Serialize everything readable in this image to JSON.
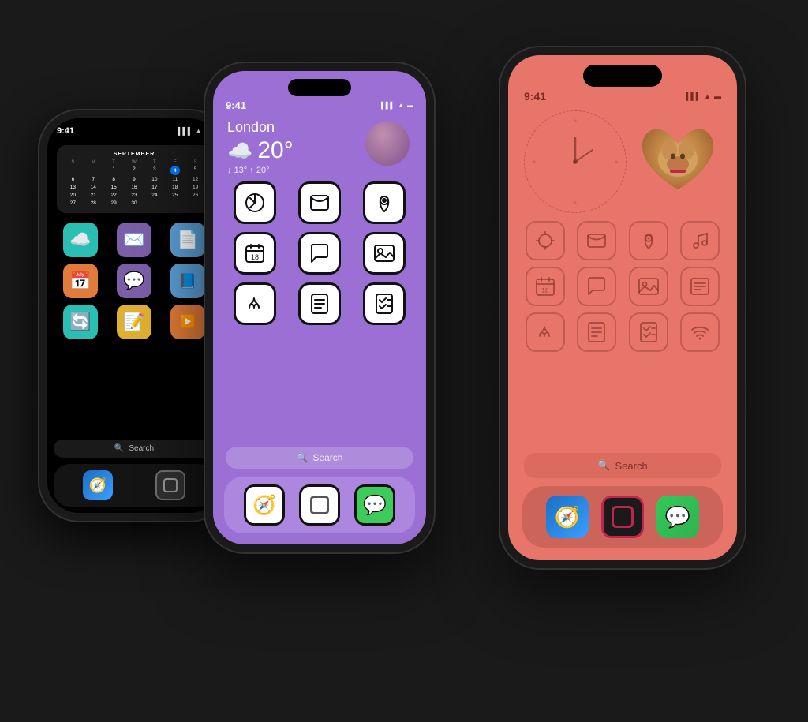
{
  "phones": {
    "left": {
      "time": "9:41",
      "background": "#000000",
      "calendar": {
        "month": "SEPTEMBER",
        "headers": [
          "S",
          "M",
          "T",
          "W",
          "T",
          "F",
          "S"
        ],
        "days": [
          "",
          "",
          "1",
          "2",
          "3",
          "4",
          "5",
          "6",
          "7",
          "8",
          "9",
          "10",
          "11",
          "12",
          "13",
          "14",
          "15",
          "16",
          "17",
          "18",
          "19",
          "20",
          "21",
          "22",
          "23",
          "24",
          "25",
          "26",
          "27",
          "28",
          "29",
          "30"
        ]
      },
      "apps": [
        {
          "icon": "☁️",
          "bg": "#2bbfb3"
        },
        {
          "icon": "✉️",
          "bg": "#7b5ea7"
        },
        {
          "icon": "📄",
          "bg": "#5b9fd6"
        },
        {
          "icon": "📅",
          "bg": "#e07b3a"
        },
        {
          "icon": "💬",
          "bg": "#7b5ea7"
        },
        {
          "icon": "📙",
          "bg": "#5b9fd6"
        },
        {
          "icon": "🔄",
          "bg": "#2bbfb3"
        },
        {
          "icon": "📝",
          "bg": "#e0b030"
        }
      ],
      "search_label": "Search",
      "dock_apps": [
        "🧭",
        "⬜"
      ]
    },
    "middle": {
      "time": "9:41",
      "background": "#9b6fd4",
      "weather": {
        "city": "London",
        "temp": "20°",
        "condition": "☁️",
        "low": "13°",
        "high": "20°"
      },
      "search_label": "Search",
      "dock_apps": [
        "safari",
        "square",
        "messages"
      ]
    },
    "right": {
      "time": "9:41",
      "background": "#e8756a",
      "signal": "▌▌▌",
      "wifi": "wifi",
      "battery": "battery",
      "search_label": "Search",
      "dock_apps": [
        "safari",
        "square_pink",
        "messages"
      ]
    }
  },
  "icons": {
    "search": "🔍"
  }
}
